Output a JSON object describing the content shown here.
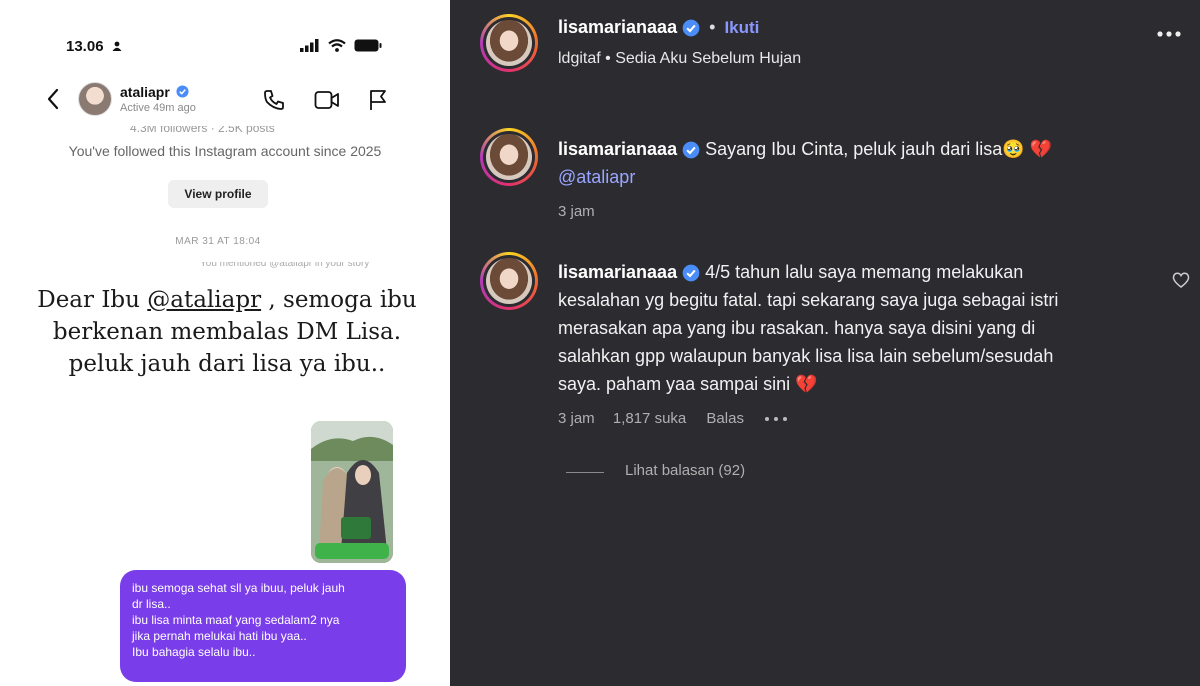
{
  "dm": {
    "status_time": "13.06",
    "username": "ataliapr",
    "active_status": "Active 49m ago",
    "followers_partial": "4.3M followers · 2.5K posts",
    "followed_since": "You've followed this Instagram account since 2025",
    "view_profile_label": "View profile",
    "date_separator": "MAR 31 AT 18:04",
    "mention_notice_partial": "You mentioned @ataliapr in your story",
    "story_text_before": "Dear Ibu ",
    "story_mention": "@ataliapr",
    "story_text_after": " , semoga ibu berkenan membalas DM Lisa. peluk jauh dari lisa ya ibu..",
    "message_lines": [
      "ibu semoga sehat sll ya ibuu, peluk jauh",
      "dr lisa..",
      "ibu lisa minta maaf yang sedalam2 nya",
      "jika pernah melukai hati ibu yaa..",
      "Ibu bahagia selalu ibu.."
    ]
  },
  "post": {
    "username": "lisamarianaaa",
    "separator": "•",
    "follow_label": "Ikuti",
    "music": "ldgitaf • Sedia Aku Sebelum Hujan",
    "caption_text": "Sayang Ibu Cinta, peluk jauh dari lisa",
    "caption_emoji": "🥹 💔",
    "caption_mention": "@ataliapr",
    "caption_time": "3 jam"
  },
  "comment": {
    "username": "lisamarianaaa",
    "lines": [
      "4/5 tahun lalu saya memang melakukan",
      "kesalahan yg begitu fatal. tapi sekarang saya juga sebagai istri",
      "merasakan apa yang ibu rasakan. hanya saya disini yang di",
      "salahkan gpp walaupun banyak lisa lisa lain sebelum/sesudah",
      "saya. paham yaa sampai sini 💔"
    ],
    "time": "3 jam",
    "likes": "1,817 suka",
    "reply_label": "Balas",
    "view_replies": "Lihat balasan (92)"
  },
  "colors": {
    "dark_bg": "#2b2b30",
    "dm_bubble": "#7a3dea",
    "verified": "#4a8df8",
    "follow": "#8b96ff"
  },
  "icons": [
    "back-arrow-icon",
    "phone-icon",
    "video-camera-icon",
    "flag-icon",
    "verified-badge-icon",
    "more-icon",
    "heart-icon"
  ]
}
